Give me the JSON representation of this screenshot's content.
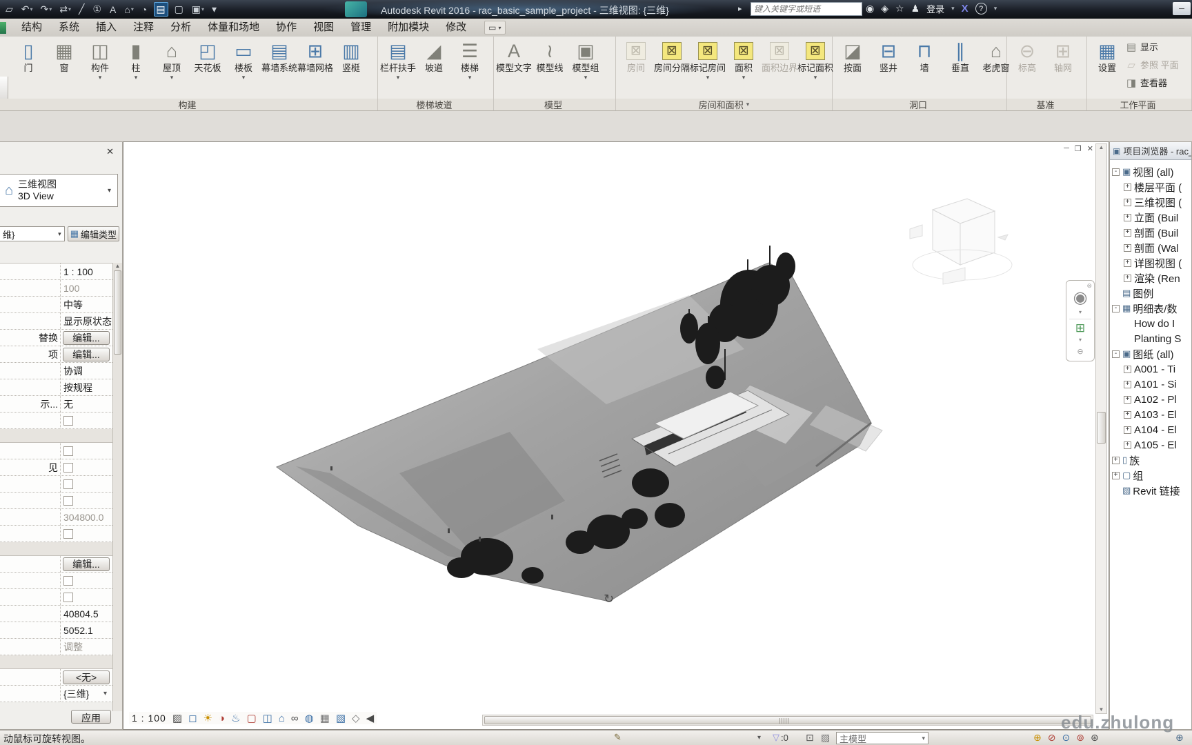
{
  "titlebar": {
    "title": "Autodesk Revit 2016 -   rac_basic_sample_project - 三维视图: {三维}",
    "next_arrow": "▸",
    "search_placeholder": "键入关键字或短语",
    "signin_label": "登录",
    "dd": "▾",
    "exchange": "X",
    "help": "?",
    "min": "─",
    "qat": [
      {
        "g": "▱",
        "cls": ""
      },
      {
        "g": "↶",
        "arrow": "▾"
      },
      {
        "g": "↷",
        "arrow": "▾"
      },
      {
        "g": "⇄",
        "arrow": "▾"
      },
      {
        "g": "╱"
      },
      {
        "g": "①"
      },
      {
        "g": "A"
      },
      {
        "g": "⌂",
        "arrow": "▾"
      },
      {
        "g": "◔"
      },
      {
        "g": "▤",
        "cls": "hl"
      },
      {
        "g": "▢"
      },
      {
        "g": "▣",
        "arrow": "▾"
      },
      {
        "g": "▾"
      }
    ],
    "right_icons": [
      {
        "g": "◉",
        "name": "search-binoculars-icon"
      },
      {
        "g": "◈",
        "name": "communication-center-icon"
      },
      {
        "g": "☆",
        "name": "favorites-icon"
      },
      {
        "g": "♟",
        "name": "profile-icon"
      }
    ]
  },
  "ribbon": {
    "tabs": [
      "结构",
      "系统",
      "插入",
      "注释",
      "分析",
      "体量和场地",
      "协作",
      "视图",
      "管理",
      "附加模块",
      "修改"
    ],
    "tab_toggle_g": "▭",
    "tab_toggle_arrow": "▾",
    "panels": [
      {
        "label": "构建",
        "arrow": "",
        "buttons": [
          {
            "label": "门",
            "g": "▯",
            "icls": "bl"
          },
          {
            "label": "窗",
            "g": "▦"
          },
          {
            "label": "构件",
            "g": "◫",
            "arrow": "▾"
          },
          {
            "label": "柱",
            "g": "▮",
            "arrow": "▾"
          },
          {
            "label": "屋顶",
            "g": "⌂",
            "arrow": "▾"
          },
          {
            "label": "天花板",
            "g": "◰",
            "icls": "bl"
          },
          {
            "label": "楼板",
            "g": "▭",
            "arrow": "▾",
            "icls": "bl"
          },
          {
            "label": "幕墙系统",
            "g": "▤",
            "icls": "bl"
          },
          {
            "label": "幕墙网格",
            "g": "⊞",
            "icls": "bl"
          },
          {
            "label": "竖梃",
            "g": "▥",
            "icls": "bl"
          }
        ]
      },
      {
        "label": "楼梯坡道",
        "arrow": "",
        "buttons": [
          {
            "label": "栏杆扶手",
            "g": "▤",
            "arrow": "▾",
            "icls": "bl"
          },
          {
            "label": "坡道",
            "g": "◢"
          },
          {
            "label": "楼梯",
            "g": "☰",
            "arrow": "▾"
          }
        ]
      },
      {
        "label": "模型",
        "arrow": "",
        "buttons": [
          {
            "label": "模型文字",
            "g": "A"
          },
          {
            "label": "模型线",
            "g": "≀"
          },
          {
            "label": "模型组",
            "g": "▣",
            "arrow": "▾"
          }
        ]
      },
      {
        "label": "房间和面积",
        "arrow": "▾",
        "buttons": [
          {
            "label": "房间",
            "g": "⊠",
            "cls": "dis",
            "icls": "yl-dis"
          },
          {
            "label": "房间分隔",
            "g": "⊠",
            "icls": "yl"
          },
          {
            "label": "标记房间",
            "g": "⊠",
            "arrow": "▾",
            "icls": "yl"
          },
          {
            "label": "面积",
            "g": "⊠",
            "arrow": "▾",
            "icls": "yl"
          },
          {
            "label": "面积边界",
            "g": "⊠",
            "cls": "dis",
            "icls": "yl-dis"
          },
          {
            "label": "标记面积",
            "g": "⊠",
            "arrow": "▾",
            "icls": "yl"
          }
        ]
      },
      {
        "label": "洞口",
        "arrow": "",
        "buttons": [
          {
            "label": "按面",
            "g": "◪"
          },
          {
            "label": "竖井",
            "g": "⊟",
            "icls": "bl"
          },
          {
            "label": "墙",
            "g": "⊓",
            "icls": "bl"
          },
          {
            "label": "垂直",
            "g": "∥",
            "icls": "bl"
          },
          {
            "label": "老虎窗",
            "g": "⌂"
          }
        ]
      },
      {
        "label": "基准",
        "arrow": "",
        "buttons": [
          {
            "label": "标高",
            "g": "⊖",
            "cls": "dis"
          },
          {
            "label": "轴网",
            "g": "⊞",
            "cls": "dis"
          }
        ]
      },
      {
        "label": "工作平面",
        "arrow": "",
        "buttons": [
          {
            "label": "设置",
            "g": "▦",
            "icls": "bl"
          },
          {
            "label": "显示",
            "g": "▤",
            "cls": "sm"
          },
          {
            "label": "参照 平面",
            "g": "▱",
            "cls": "sm dis"
          },
          {
            "label": "查看器",
            "g": "◨",
            "cls": "sm"
          }
        ]
      }
    ]
  },
  "properties": {
    "close_icon": "✕",
    "type_name": "三维视图",
    "type_name_en": "3D View",
    "selection_text": "维}",
    "edit_type_label": "编辑类型",
    "apply_label": "应用",
    "rows": [
      {
        "label": "",
        "value": "1 : 100",
        "cls": "text"
      },
      {
        "label": "",
        "value": "100",
        "cls": "text gray"
      },
      {
        "label": "",
        "value": "中等",
        "cls": "text"
      },
      {
        "label": "",
        "value": "显示原状态",
        "cls": "text"
      },
      {
        "label": "替换",
        "value": "编辑...",
        "cls": "btn"
      },
      {
        "label": "项",
        "value": "编辑...",
        "cls": "btn"
      },
      {
        "label": "",
        "value": "协调",
        "cls": "text"
      },
      {
        "label": "",
        "value": "按规程",
        "cls": "text"
      },
      {
        "label": "示...",
        "value": "无",
        "cls": "text"
      },
      {
        "label": "",
        "value": "",
        "cls": "check"
      },
      {
        "label": "",
        "value": "",
        "cls": "section"
      },
      {
        "label": "",
        "value": "",
        "cls": "check"
      },
      {
        "label": "见",
        "value": "",
        "cls": "check"
      },
      {
        "label": "",
        "value": "",
        "cls": "check"
      },
      {
        "label": "",
        "value": "",
        "cls": "check"
      },
      {
        "label": "",
        "value": "304800.0",
        "cls": "text gray"
      },
      {
        "label": "",
        "value": "",
        "cls": "check"
      },
      {
        "label": "",
        "value": "",
        "cls": "section"
      },
      {
        "label": "",
        "value": "编辑...",
        "cls": "btn"
      },
      {
        "label": "",
        "value": "",
        "cls": "check"
      },
      {
        "label": "",
        "value": "",
        "cls": "check"
      },
      {
        "label": "",
        "value": "40804.5",
        "cls": "text"
      },
      {
        "label": "",
        "value": "5052.1",
        "cls": "text"
      },
      {
        "label": "",
        "value": "调整",
        "cls": "text gray"
      },
      {
        "label": "",
        "value": "",
        "cls": "section"
      },
      {
        "label": "",
        "value": "<无>",
        "cls": "btn"
      },
      {
        "label": "",
        "value": "{三维}",
        "cls": "text dd"
      }
    ]
  },
  "viewport": {
    "win_min": "─",
    "win_restore": "❐",
    "win_close": "✕",
    "orbit_icon": "↻",
    "navbar": {
      "close": "⊗",
      "wheel": "◉",
      "dd": "▾",
      "zoom": "⊞",
      "collapse": "⊖"
    }
  },
  "view_controls": {
    "scale": "1 : 100",
    "icons": [
      {
        "g": "▨",
        "cls": "c-d",
        "name": "detail-level-icon"
      },
      {
        "g": "◻",
        "cls": "c-b",
        "name": "visual-style-icon"
      },
      {
        "g": "☀",
        "cls": "c-y",
        "name": "sun-path-icon"
      },
      {
        "g": "◑",
        "cls": "c-r",
        "name": "shadows-icon"
      },
      {
        "g": "♨",
        "cls": "c-b",
        "name": "render-dialog-icon"
      },
      {
        "g": "▢",
        "cls": "c-r",
        "name": "crop-view-icon"
      },
      {
        "g": "◫",
        "cls": "c-b",
        "name": "show-crop-icon"
      },
      {
        "g": "⌂",
        "cls": "c-b",
        "name": "unlocked-view-icon"
      },
      {
        "g": "∞",
        "cls": "c-d",
        "name": "temporary-hide-isolate-icon"
      },
      {
        "g": "◍",
        "cls": "c-b",
        "name": "reveal-hidden-icon"
      },
      {
        "g": "▦",
        "cls": "c-g",
        "name": "temporary-view-properties-icon"
      },
      {
        "g": "▧",
        "cls": "c-b",
        "name": "show-analytical-model-icon"
      },
      {
        "g": "◇",
        "cls": "c-g",
        "name": "displacement-sets-icon"
      },
      {
        "g": "◀",
        "cls": "c-d",
        "name": "collapse-bar-icon"
      }
    ]
  },
  "project_browser": {
    "title": "项目浏览器 - rac_",
    "header_icon": "▣",
    "items": [
      {
        "exp": "-",
        "g": "▣",
        "label": "视图 (all)",
        "cls": "lvl0"
      },
      {
        "exp": "+",
        "g": "",
        "label": "楼层平面 (",
        "cls": "lvl1"
      },
      {
        "exp": "+",
        "g": "",
        "label": "三维视图 (",
        "cls": "lvl1"
      },
      {
        "exp": "+",
        "g": "",
        "label": "立面 (Buil",
        "cls": "lvl1"
      },
      {
        "exp": "+",
        "g": "",
        "label": "剖面 (Buil",
        "cls": "lvl1"
      },
      {
        "exp": "+",
        "g": "",
        "label": "剖面 (Wal",
        "cls": "lvl1"
      },
      {
        "exp": "+",
        "g": "",
        "label": "详图视图 (",
        "cls": "lvl1"
      },
      {
        "exp": "+",
        "g": "",
        "label": "渲染 (Ren",
        "cls": "lvl1"
      },
      {
        "exp": "",
        "g": "▤",
        "label": "图例",
        "cls": "lvl0"
      },
      {
        "exp": "-",
        "g": "▦",
        "label": "明细表/数",
        "cls": "lvl0"
      },
      {
        "exp": "",
        "g": "",
        "label": "How do I",
        "cls": "lvl1"
      },
      {
        "exp": "",
        "g": "",
        "label": "Planting S",
        "cls": "lvl1"
      },
      {
        "exp": "-",
        "g": "▣",
        "label": "图纸 (all)",
        "cls": "lvl0"
      },
      {
        "exp": "+",
        "g": "",
        "label": "A001 - Ti",
        "cls": "lvl1"
      },
      {
        "exp": "+",
        "g": "",
        "label": "A101 - Si",
        "cls": "lvl1"
      },
      {
        "exp": "+",
        "g": "",
        "label": "A102 - Pl",
        "cls": "lvl1"
      },
      {
        "exp": "+",
        "g": "",
        "label": "A103 - El",
        "cls": "lvl1"
      },
      {
        "exp": "+",
        "g": "",
        "label": "A104 - El",
        "cls": "lvl1"
      },
      {
        "exp": "+",
        "g": "",
        "label": "A105 - El",
        "cls": "lvl1"
      },
      {
        "exp": "+",
        "g": "▯",
        "label": "族",
        "cls": "lvl0"
      },
      {
        "exp": "+",
        "g": "▢",
        "label": "组",
        "cls": "lvl0"
      },
      {
        "exp": "",
        "g": "▧",
        "label": "Revit 链接",
        "cls": "lvl0"
      }
    ]
  },
  "status_bar": {
    "message": "动鼠标可旋转视图。",
    "worksets_icon": "✎",
    "dd": "▾",
    "filter_icon": "▽",
    "filter_count": ":0",
    "i1": "⊡",
    "i2": "▨",
    "model_combo": "主模型",
    "icons": [
      {
        "g": "⊕",
        "cls": "c-y",
        "name": "select-links-icon"
      },
      {
        "g": "⊘",
        "cls": "c-r",
        "name": "select-underlay-icon"
      },
      {
        "g": "⊙",
        "cls": "c-b",
        "name": "select-pinned-icon"
      },
      {
        "g": "⊚",
        "cls": "c-r",
        "name": "select-by-face-icon"
      },
      {
        "g": "⊛",
        "cls": "c-d",
        "name": "drag-on-selection-icon"
      }
    ],
    "cut_icons": [
      {
        "g": "⊕",
        "name": "background-process-icon"
      }
    ]
  },
  "watermark": "edu.zhulong"
}
